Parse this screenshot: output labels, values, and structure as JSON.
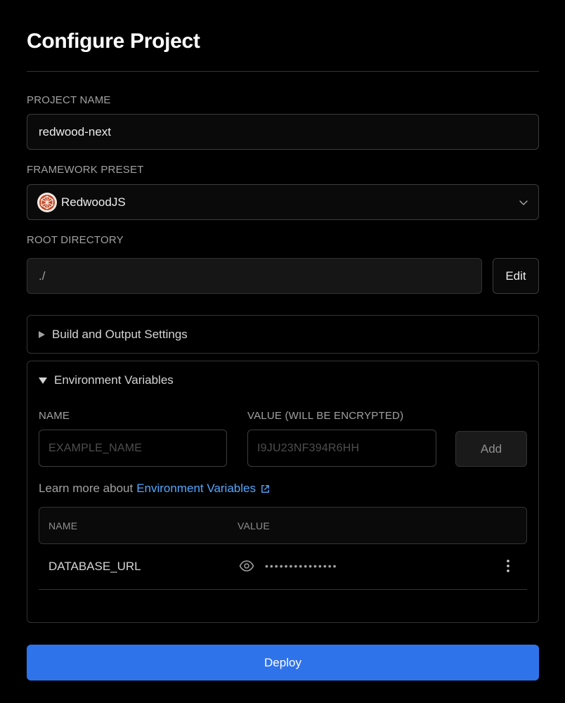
{
  "page": {
    "title": "Configure Project"
  },
  "project_name": {
    "label": "PROJECT NAME",
    "value": "redwood-next"
  },
  "framework": {
    "label": "FRAMEWORK PRESET",
    "selected": "RedwoodJS",
    "icon": "redwoodjs-logo-icon"
  },
  "root_directory": {
    "label": "ROOT DIRECTORY",
    "value": "./",
    "edit_label": "Edit"
  },
  "build_settings": {
    "label": "Build and Output Settings",
    "expanded": false
  },
  "env_vars": {
    "label": "Environment Variables",
    "expanded": true,
    "name_label": "NAME",
    "value_label": "VALUE (WILL BE ENCRYPTED)",
    "name_placeholder": "EXAMPLE_NAME",
    "value_placeholder": "I9JU23NF394R6HH",
    "add_label": "Add",
    "learn_prefix": "Learn more about",
    "learn_link": "Environment Variables",
    "table": {
      "columns": [
        "NAME",
        "VALUE"
      ],
      "rows": [
        {
          "name": "DATABASE_URL",
          "value_masked": "•••••••••••••••"
        }
      ]
    }
  },
  "deploy": {
    "label": "Deploy"
  },
  "colors": {
    "background": "#000000",
    "accent": "#2f73ea",
    "link": "#52a8ff",
    "border": "#333333"
  }
}
